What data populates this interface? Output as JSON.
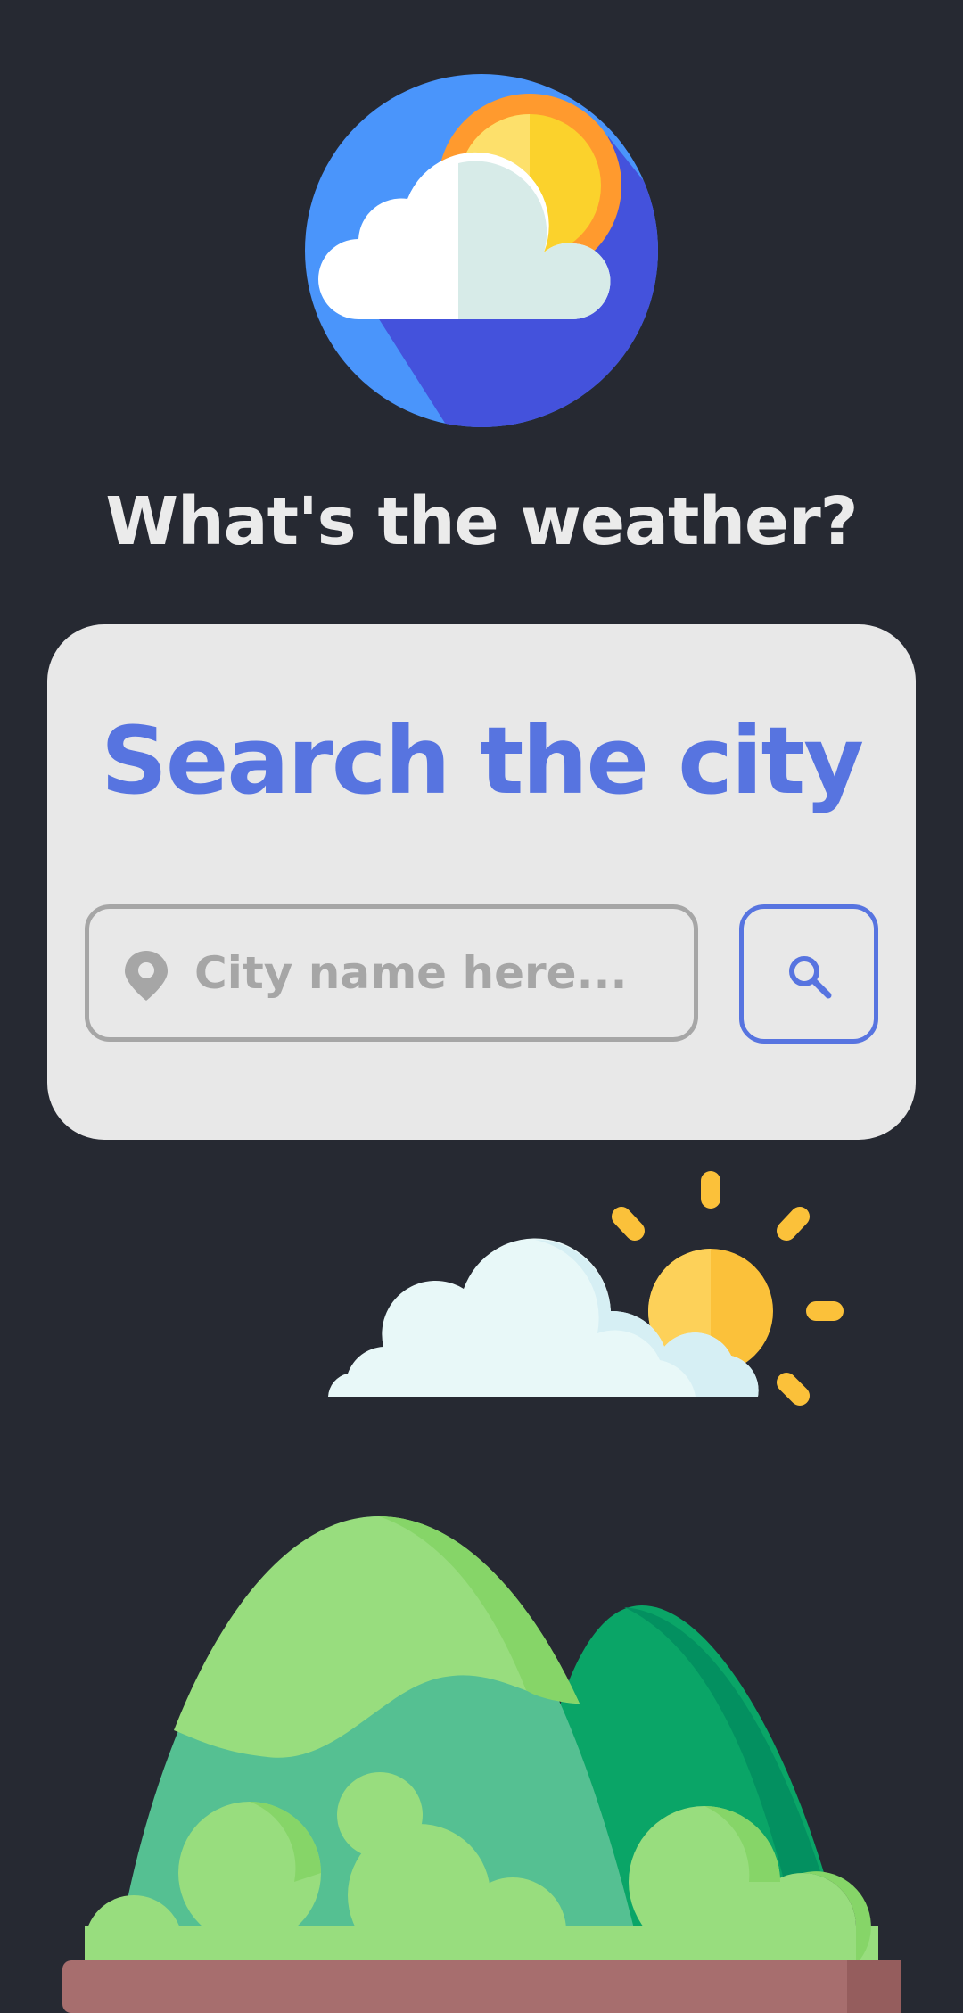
{
  "header": {
    "title": "What's the weather?",
    "logo_icon": "weather-sun-cloud-icon"
  },
  "search": {
    "title": "Search the city",
    "placeholder": "City name here...",
    "value": "",
    "location_icon": "location-pin-icon",
    "button_icon": "search-icon"
  },
  "illustrations": {
    "sun_cloud": "sun-behind-cloud-icon",
    "landscape": "green-mountains-illustration"
  },
  "colors": {
    "background": "#262932",
    "card": "#e8e8e8",
    "accent": "#5774e0",
    "title_text": "#ebebeb",
    "input_border": "#a6a6a6"
  }
}
